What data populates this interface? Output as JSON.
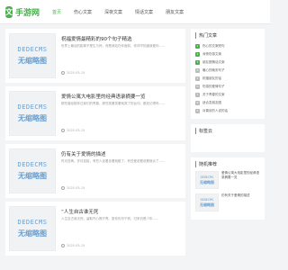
{
  "header": {
    "logo_mark": "文",
    "logo_text": "手游网",
    "nav": [
      "首页",
      "伤心文案",
      "深夜文案",
      "情话文案",
      "朋友文案"
    ]
  },
  "thumb": {
    "line1": "DEDECMS",
    "line2": "无缩略图"
  },
  "articles": [
    {
      "title": "祝福爱情最精彩的90个句子精选",
      "excerpt": "世界上最远的距离不是生与死，而是我站在你面前，你却不知道我爱你……",
      "date": "2025-05-15"
    },
    {
      "title": "爱情公寓大电影里的经典语录摘要一览",
      "excerpt": "那些曾经陪伴过我们的青春，那些笑着笑着就哭了的台词，都还记得吗……",
      "date": "2025-05-15"
    },
    {
      "title": "仍有关于爱情的描述",
      "excerpt": "时光荏苒，岁月如梭，有些人走着走着就散了，有些爱说着说着就淡了……",
      "date": "2025-05-15"
    },
    {
      "title": "“人生自古谁无死",
      "excerpt": "人生自古谁无死，留取丹心照汗青。愿你历尽千帆，归来仍是少年……",
      "date": "2025-05-15"
    }
  ],
  "sidebar": {
    "hot_title": "热门文章",
    "hot_items": [
      "伤心的文案短句",
      "深夜伤感文案",
      "朋友圈情话文案",
      "暖心的晚安句子",
      "祝福朋友的话",
      "伤感的爱情句子",
      "关于青春的文案",
      "适合发朋友圈",
      "对喜欢的人说的话"
    ],
    "tags_title": "标签云",
    "rec_title": "随机推荐",
    "rec_items": [
      "爱情公寓大电影里的经典语录摘要一览",
      "仍有关于爱情的描述"
    ]
  }
}
